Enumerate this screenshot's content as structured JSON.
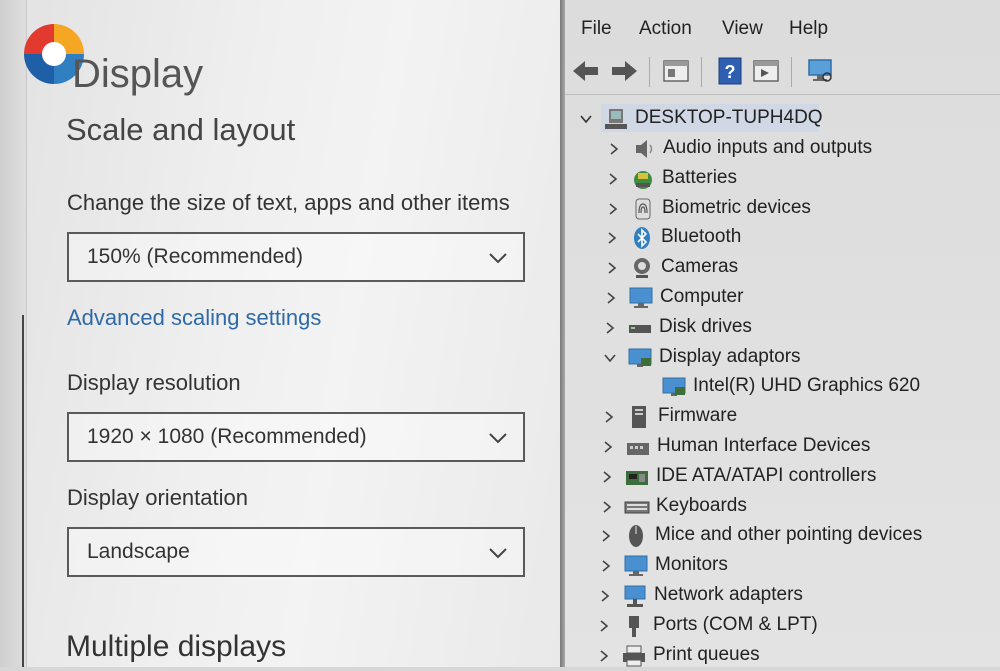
{
  "settings": {
    "title": "Display",
    "section_title": "Scale and layout",
    "scale_label": "Change the size of text, apps and other items",
    "scale_value": "150% (Recommended)",
    "advanced_link": "Advanced scaling settings",
    "resolution_label": "Display resolution",
    "resolution_value": "1920 × 1080 (Recommended)",
    "orientation_label": "Display orientation",
    "orientation_value": "Landscape",
    "multiple_displays": "Multiple displays"
  },
  "device_manager": {
    "menu": [
      "File",
      "Action",
      "View",
      "Help"
    ],
    "toolbar": [
      "back-arrow-icon",
      "forward-arrow-icon",
      "properties-icon",
      "help-icon",
      "update-driver-icon",
      "scan-hardware-icon"
    ],
    "root": "DESKTOP-TUPH4DQ",
    "categories": [
      {
        "label": "Audio inputs and outputs",
        "icon": "speaker-icon",
        "expanded": false
      },
      {
        "label": "Batteries",
        "icon": "battery-icon",
        "expanded": false
      },
      {
        "label": "Biometric devices",
        "icon": "fingerprint-icon",
        "expanded": false
      },
      {
        "label": "Bluetooth",
        "icon": "bluetooth-icon",
        "expanded": false
      },
      {
        "label": "Cameras",
        "icon": "camera-icon",
        "expanded": false
      },
      {
        "label": "Computer",
        "icon": "computer-icon",
        "expanded": false
      },
      {
        "label": "Disk drives",
        "icon": "disk-drive-icon",
        "expanded": false
      },
      {
        "label": "Display adaptors",
        "icon": "display-adapter-icon",
        "expanded": true
      },
      {
        "label": "Intel(R) UHD Graphics 620",
        "icon": "display-adapter-icon",
        "child": true
      },
      {
        "label": "Firmware",
        "icon": "firmware-icon",
        "expanded": false
      },
      {
        "label": "Human Interface Devices",
        "icon": "hid-icon",
        "expanded": false
      },
      {
        "label": "IDE ATA/ATAPI controllers",
        "icon": "ide-controller-icon",
        "expanded": false
      },
      {
        "label": "Keyboards",
        "icon": "keyboard-icon",
        "expanded": false
      },
      {
        "label": "Mice and other pointing devices",
        "icon": "mouse-icon",
        "expanded": false
      },
      {
        "label": "Monitors",
        "icon": "monitor-icon",
        "expanded": false
      },
      {
        "label": "Network adapters",
        "icon": "network-adapter-icon",
        "expanded": false
      },
      {
        "label": "Ports (COM & LPT)",
        "icon": "port-icon",
        "expanded": false
      },
      {
        "label": "Print queues",
        "icon": "printer-icon",
        "expanded": false
      }
    ]
  },
  "colors": {
    "link": "#2e6aa8",
    "selection": "#cfd8e4",
    "icon_blue": "#2f7fc1"
  }
}
